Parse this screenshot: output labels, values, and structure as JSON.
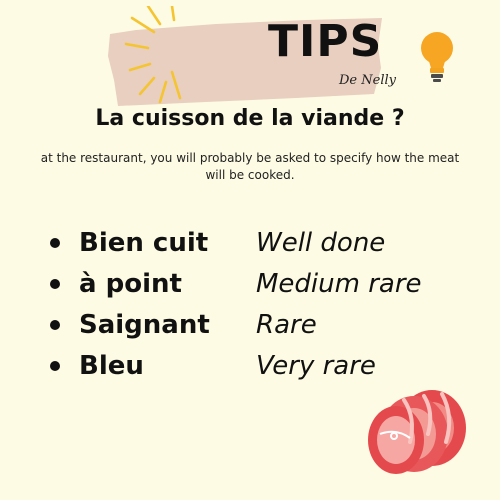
{
  "banner": {
    "title": "TIPS",
    "subtitle": "De Nelly"
  },
  "heading": "La cuisson de la viande ?",
  "intro": "at the restaurant, you will probably be asked to specify how the meat will be cooked.",
  "vocabulary": [
    {
      "term": "Bien cuit",
      "translation": "Well done"
    },
    {
      "term": "à point",
      "translation": "Medium rare"
    },
    {
      "term": "Saignant",
      "translation": "Rare"
    },
    {
      "term": "Bleu",
      "translation": "Very rare"
    }
  ],
  "colors": {
    "background": "#fdfbe4",
    "banner": "#e9cfc0",
    "sunburst": "#f4c431",
    "bulb": "#f6a623",
    "meat_outer": "#e44a4d",
    "meat_inner": "#f7a7a3"
  },
  "icons": [
    "sunburst-icon",
    "light-bulb-icon",
    "meat-roast-icon"
  ]
}
